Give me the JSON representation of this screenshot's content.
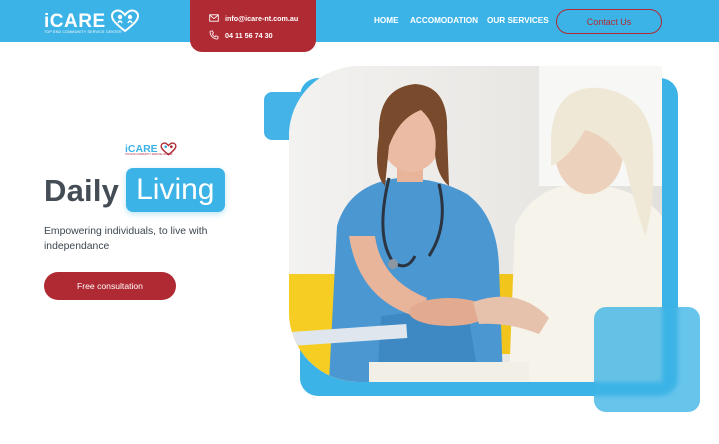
{
  "brand": {
    "name": "iCARE",
    "tagline": "TOP END COMMUNITY SERVICE CENTER",
    "colors": {
      "primary": "#3cb3e6",
      "accent": "#b02a33",
      "text": "#444c55"
    }
  },
  "contact": {
    "email": "info@icare-nt.com.au",
    "phone": "04 11 56 74 30",
    "email_icon": "envelope-icon",
    "phone_icon": "phone-icon"
  },
  "nav": {
    "items": [
      {
        "label": "HOME"
      },
      {
        "label": "ACCOMODATION"
      },
      {
        "label": "OUR SERVICES"
      }
    ],
    "contact_button": "Contact Us"
  },
  "hero": {
    "mini_logo": "iCARE",
    "mini_tagline": "TOP END COMMUNITY SERVICE CENTER",
    "title_dark": "Daily",
    "title_highlight": "Living",
    "subtitle": "Empowering individuals, to live with independance",
    "cta_label": "Free consultation",
    "image_subject": "nurse-holding-elderly-woman-hands-photo"
  }
}
